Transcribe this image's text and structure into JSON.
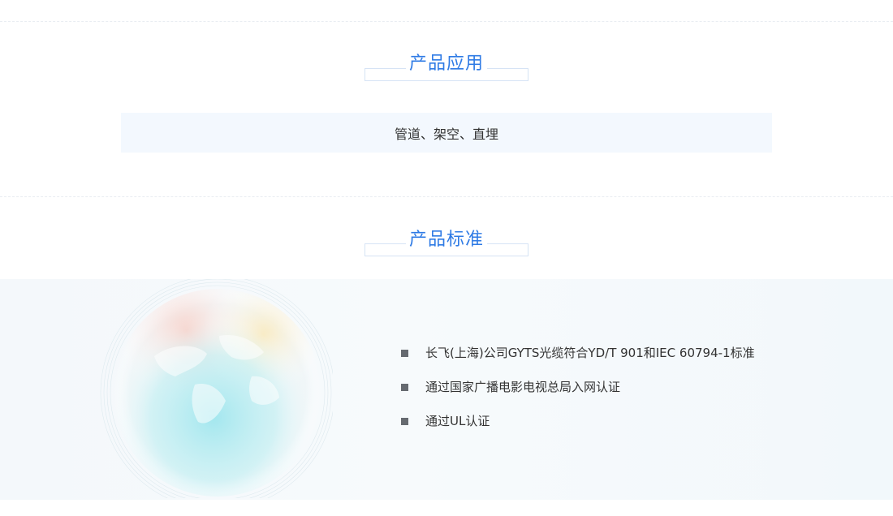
{
  "sections": {
    "application": {
      "title": "产品应用",
      "content": "管道、架空、直埋"
    },
    "standards": {
      "title": "产品标准",
      "items": [
        "长飞(上海)公司GYTS光缆符合YD/T 901和IEC 60794-1标准",
        "通过国家广播电影电视总局入网认证",
        "通过UL认证"
      ]
    }
  },
  "colors": {
    "heading_blue": "#2f7be5",
    "box_background": "#f3f8fe",
    "bullet": "#666a70",
    "frame_border": "#d6e3f5"
  },
  "icons": {
    "decorative_globe": "globe-illustration",
    "list_bullet": "square-bullet-icon"
  }
}
